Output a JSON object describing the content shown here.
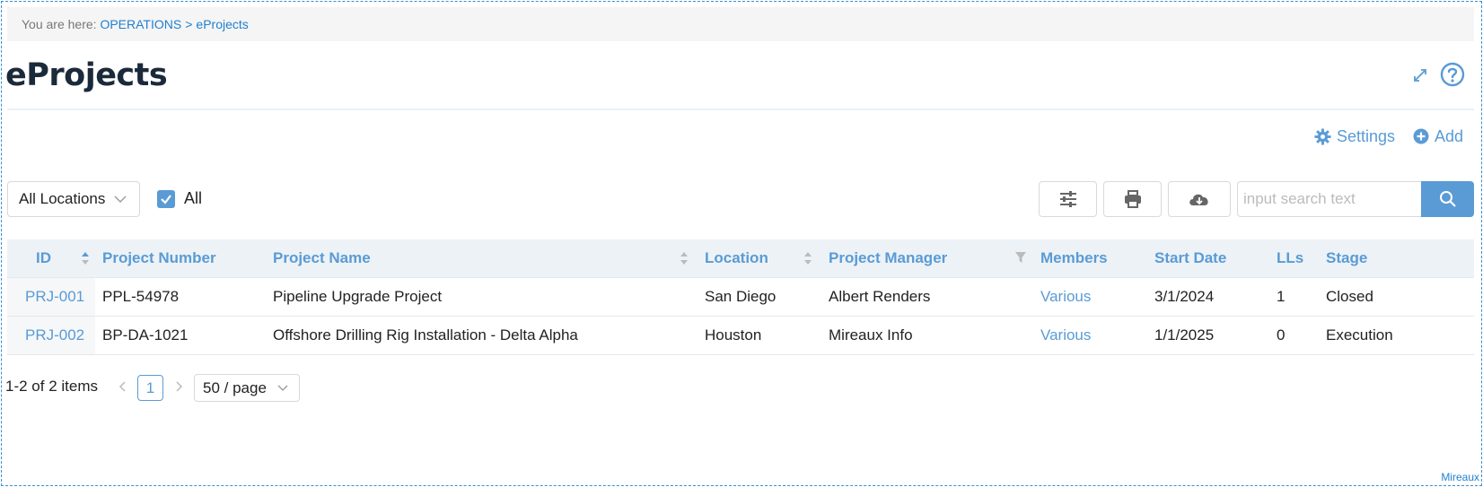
{
  "breadcrumb": {
    "prefix": "You are here:",
    "items": [
      "OPERATIONS",
      "eProjects"
    ],
    "separator": ">"
  },
  "page": {
    "title": "eProjects",
    "icons": [
      "expand-icon",
      "help-icon"
    ]
  },
  "actions": {
    "settings_label": "Settings",
    "add_label": "Add"
  },
  "filters": {
    "location_selected": "All Locations",
    "all_label": "All",
    "all_checked": true
  },
  "toolbar": {
    "icons": [
      "sliders-icon",
      "print-icon",
      "cloud-download-icon",
      "search-icon"
    ]
  },
  "search": {
    "placeholder": "input search text",
    "value": ""
  },
  "table": {
    "columns": [
      "ID",
      "Project Number",
      "Project Name",
      "Location",
      "Project Manager",
      "Members",
      "Start Date",
      "LLs",
      "Stage"
    ],
    "rows": [
      {
        "id": "PRJ-001",
        "project_number": "PPL-54978",
        "project_name": "Pipeline Upgrade Project",
        "location": "San Diego",
        "project_manager": "Albert Renders",
        "members": "Various",
        "start_date": "3/1/2024",
        "lls": "1",
        "stage": "Closed"
      },
      {
        "id": "PRJ-002",
        "project_number": "BP-DA-1021",
        "project_name": "Offshore Drilling Rig Installation - Delta Alpha",
        "location": "Houston",
        "project_manager": "Mireaux Info",
        "members": "Various",
        "start_date": "1/1/2025",
        "lls": "0",
        "stage": "Execution"
      }
    ]
  },
  "pagination": {
    "total_text": "1-2 of 2 items",
    "current_page": "1",
    "page_size": "50 / page"
  },
  "footer": {
    "brand": "Mireaux"
  },
  "colors": {
    "accent": "#5a9bd5",
    "link": "#1f7fd1",
    "title": "#1b2a3a",
    "header_bg": "#edf2f6"
  }
}
